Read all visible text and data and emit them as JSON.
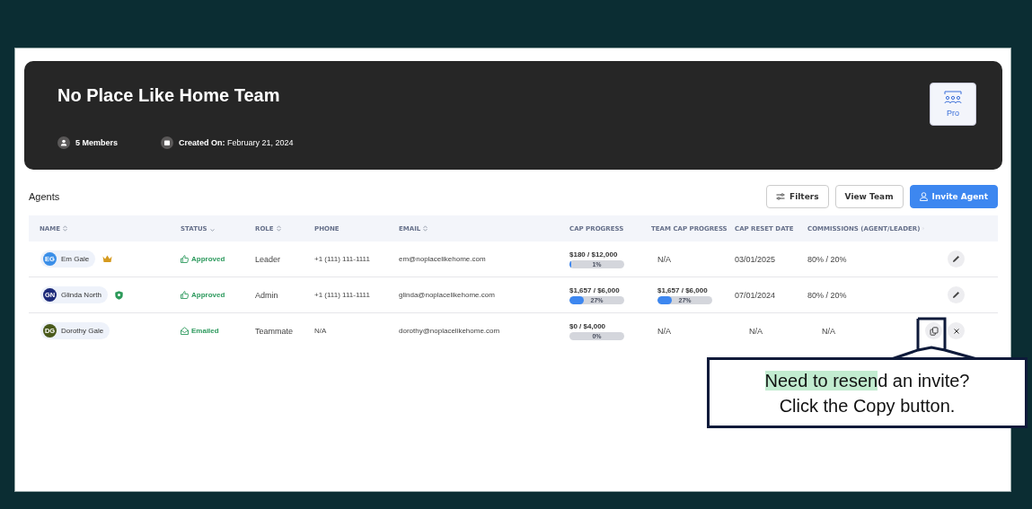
{
  "team": {
    "title": "No Place Like Home Team",
    "members": "5 Members",
    "created_label": "Created On:",
    "created_date": "February 21, 2024",
    "plan": "Pro"
  },
  "agents": {
    "title": "Agents",
    "buttons": [
      {
        "label": "Filters",
        "kind": "filter"
      },
      {
        "label": "View Team",
        "kind": "plain"
      },
      {
        "label": "Invite Agent",
        "kind": "primary"
      }
    ]
  },
  "table": {
    "columns": [
      {
        "label": "NAME",
        "kind": "sortable"
      },
      {
        "label": "STATUS",
        "kind": "sorted_desc"
      },
      {
        "label": "ROLE",
        "kind": "sortable"
      },
      {
        "label": "PHONE",
        "kind": "plain"
      },
      {
        "label": "EMAIL",
        "kind": "sortable"
      },
      {
        "label": "CAP PROGRESS",
        "kind": "plain"
      },
      {
        "label": "TEAM CAP PROGRESS",
        "kind": "plain"
      },
      {
        "label": "CAP RESET DATE",
        "kind": "plain"
      },
      {
        "label": "COMMISSIONS (AGENT/LEADER)",
        "kind": "sortable"
      }
    ],
    "rows": [
      {
        "initials": "EG",
        "color": "#3b8fe8",
        "name": "Em Gale",
        "badge": {
          "kind": "crown"
        },
        "status": {
          "text": "Approved",
          "kind": "approved"
        },
        "role": "Leader",
        "phone": "+1 (111) 111-1111",
        "email": "em@noplacelikehome.com",
        "cap": {
          "amount": "$180 / $12,000",
          "level": 0.01,
          "percent": "1%"
        },
        "team_cap": {
          "kind": "text",
          "text": "N/A"
        },
        "reset_date": "03/01/2025",
        "commissions": "80% / 20%",
        "actions": {
          "kind": "edit"
        }
      },
      {
        "initials": "GN",
        "color": "#1c2a7a",
        "name": "Glinda North",
        "badge": {
          "kind": "shield"
        },
        "status": {
          "text": "Approved",
          "kind": "approved"
        },
        "role": "Admin",
        "phone": "+1 (111) 111-1111",
        "email": "glinda@noplacelikehome.com",
        "cap": {
          "amount": "$1,657 / $6,000",
          "level": 0.27,
          "percent": "27%"
        },
        "team_cap": {
          "kind": "progress",
          "amount": "$1,657 / $6,000",
          "level": 0.27,
          "percent": "27%"
        },
        "reset_date": "07/01/2024",
        "commissions": "80% / 20%",
        "actions": {
          "kind": "edit"
        }
      },
      {
        "initials": "DG",
        "color": "#4a5a1c",
        "name": "Dorothy Gale",
        "status": {
          "text": "Emailed",
          "kind": "emailed"
        },
        "role": "Teammate",
        "phone": "N/A",
        "email": "dorothy@noplacelikehome.com",
        "cap": {
          "amount": "$0 / $4,000",
          "level": 0,
          "percent": "0%"
        },
        "team_cap": {
          "kind": "text",
          "text": "N/A"
        },
        "reset_date": "N/A",
        "commissions": "N/A",
        "actions": {
          "kind": "copy_remove"
        }
      }
    ]
  },
  "callout": {
    "highlighted_text": "Need to resen",
    "text_rest": "d an invite?",
    "line_2": "Click the Copy button."
  }
}
